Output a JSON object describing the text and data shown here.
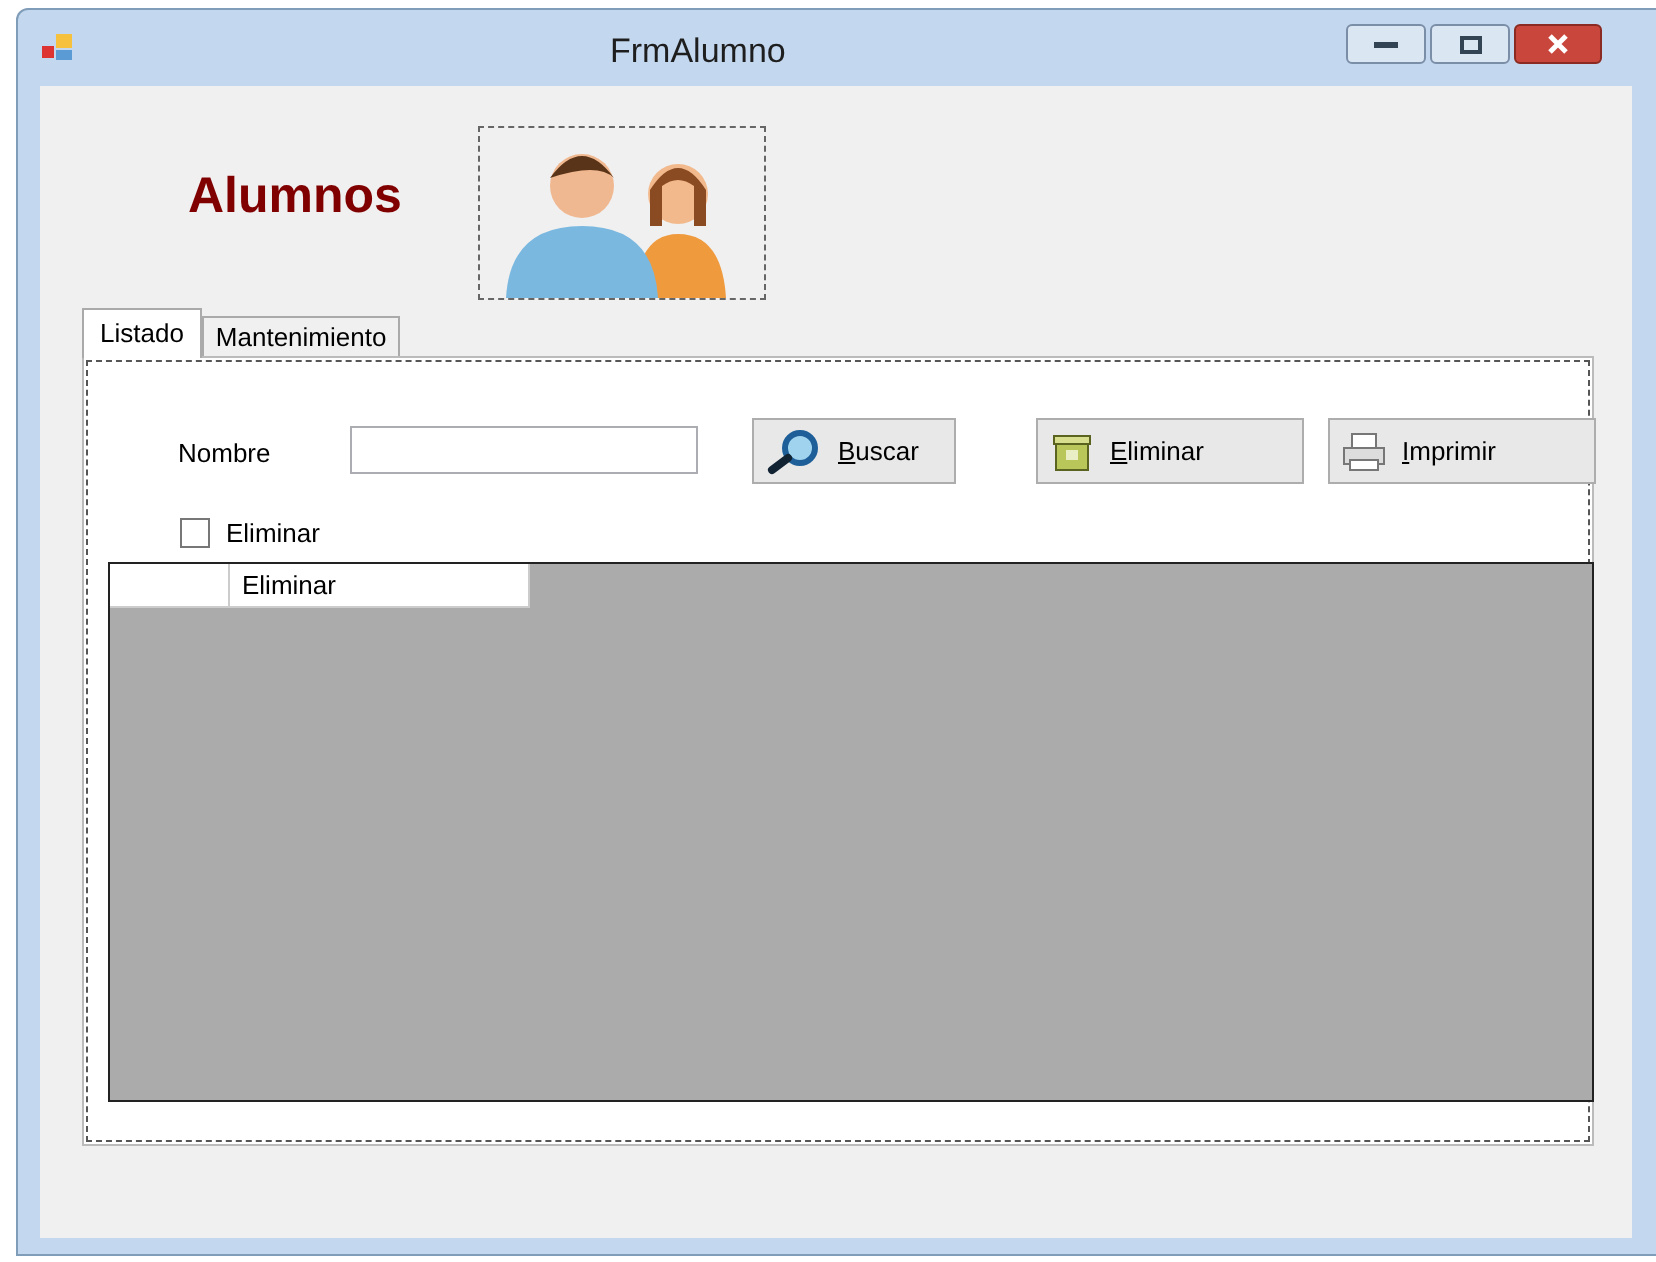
{
  "window": {
    "title": "FrmAlumno"
  },
  "header": {
    "title": "Alumnos"
  },
  "tabs": [
    {
      "label": "Listado",
      "selected": true
    },
    {
      "label": "Mantenimiento",
      "selected": false
    }
  ],
  "filter": {
    "label": "Nombre"
  },
  "buttons": [
    {
      "kind": "search",
      "label": "Buscar"
    },
    {
      "kind": "delete",
      "label": "Eliminar"
    },
    {
      "kind": "print",
      "label": "Imprimir"
    }
  ],
  "checkbox": {
    "label": "Eliminar",
    "checked": false
  },
  "grid": {
    "columns": [
      "Eliminar"
    ]
  }
}
